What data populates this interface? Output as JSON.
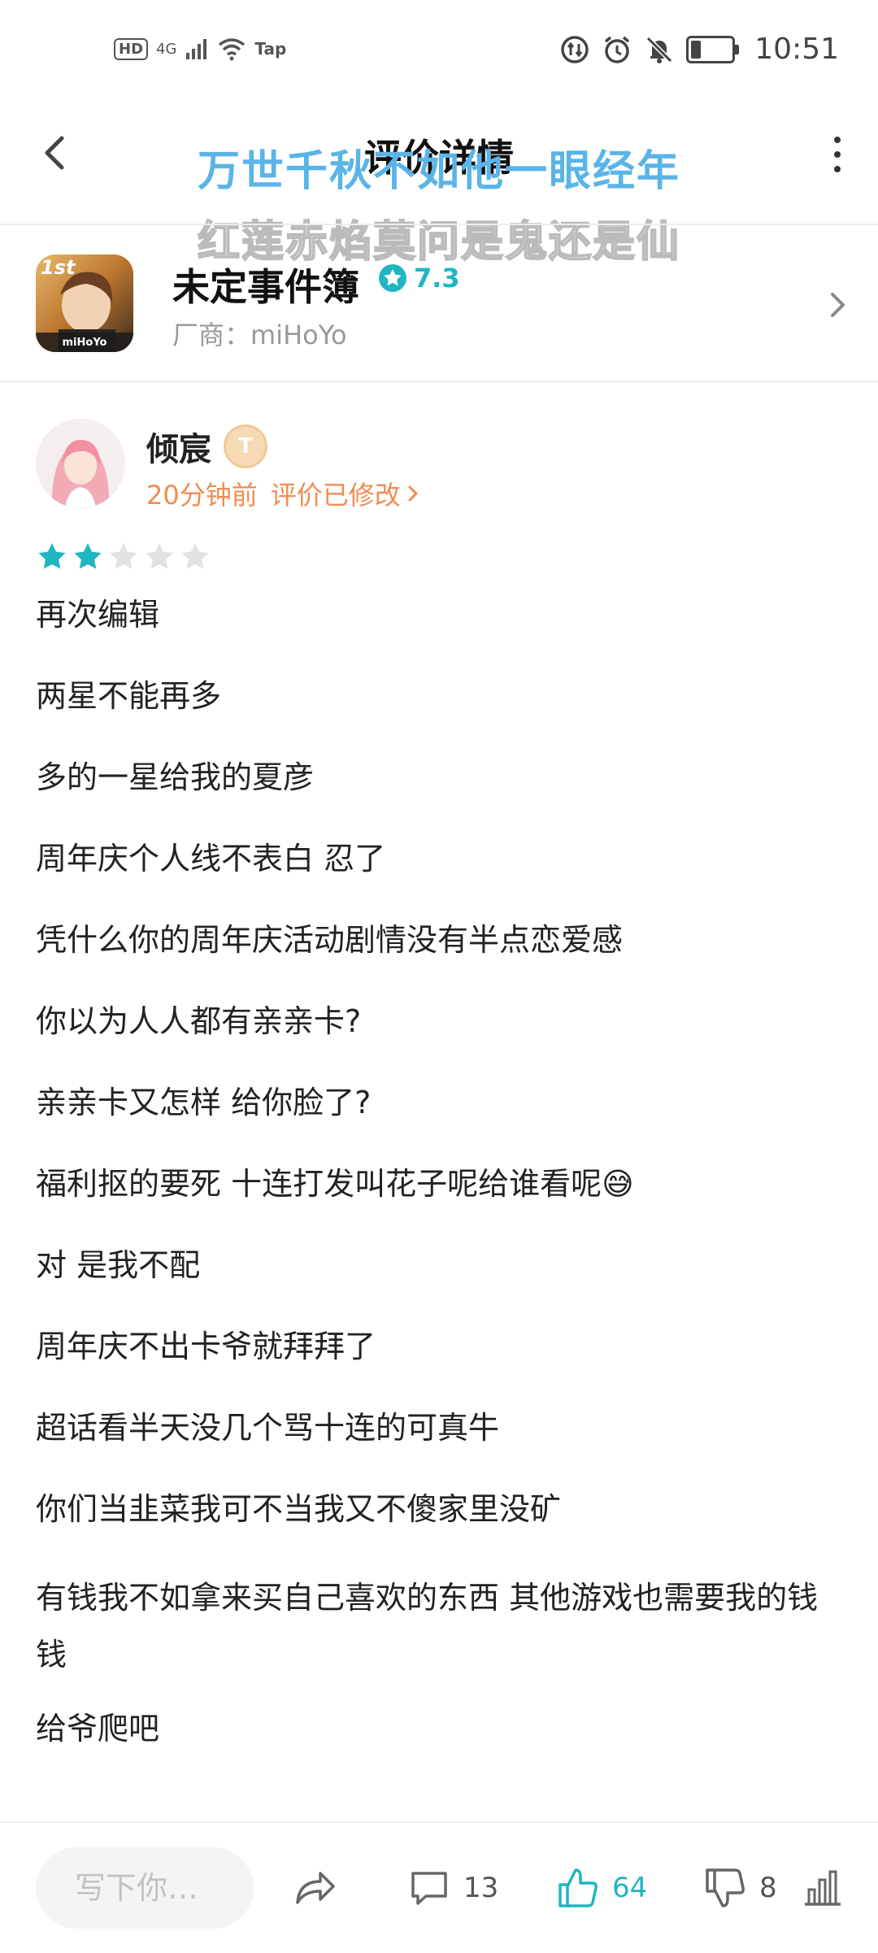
{
  "status_bar": {
    "hd": "HD",
    "network": "4G",
    "tap_label": "Tap",
    "time": "10:51"
  },
  "header": {
    "title": "评价详情",
    "overlay_line1": "万世千秋不如他一眼经年",
    "overlay_line2": "红莲赤焰莫问是鬼还是仙"
  },
  "game": {
    "icon_label_top": "1st",
    "icon_label_bottom": "miHoYo",
    "name": "未定事件簿",
    "rating": "7.3",
    "developer": "厂商：miHoYo"
  },
  "review": {
    "username": "倾宸",
    "badge": "T",
    "time": "20分钟前",
    "edited_label": "评价已修改",
    "stars_filled": 2,
    "stars_total": 5,
    "lines": [
      "再次编辑",
      "两星不能再多",
      "多的一星给我的夏彦",
      "周年庆个人线不表白 忍了",
      "凭什么你的周年庆活动剧情没有半点恋爱感",
      "你以为人人都有亲亲卡?",
      "亲亲卡又怎样 给你脸了?",
      "福利抠的要死 十连打发叫花子呢给谁看呢😅",
      "对 是我不配",
      "周年庆不出卡爷就拜拜了",
      "超话看半天没几个骂十连的可真牛",
      "你们当韭菜我可不当我又不傻家里没矿",
      "有钱我不如拿来买自己喜欢的东西 其他游戏也需要我的钱钱",
      "给爷爬吧"
    ],
    "cut_line": "———————"
  },
  "bottom_bar": {
    "reply_placeholder": "写下你…",
    "comment_count": "13",
    "like_count": "64",
    "dislike_count": "8"
  },
  "colors": {
    "accent": "#1fb6c1",
    "orange": "#f08c52",
    "overlay_blue": "#5ab4e8"
  }
}
